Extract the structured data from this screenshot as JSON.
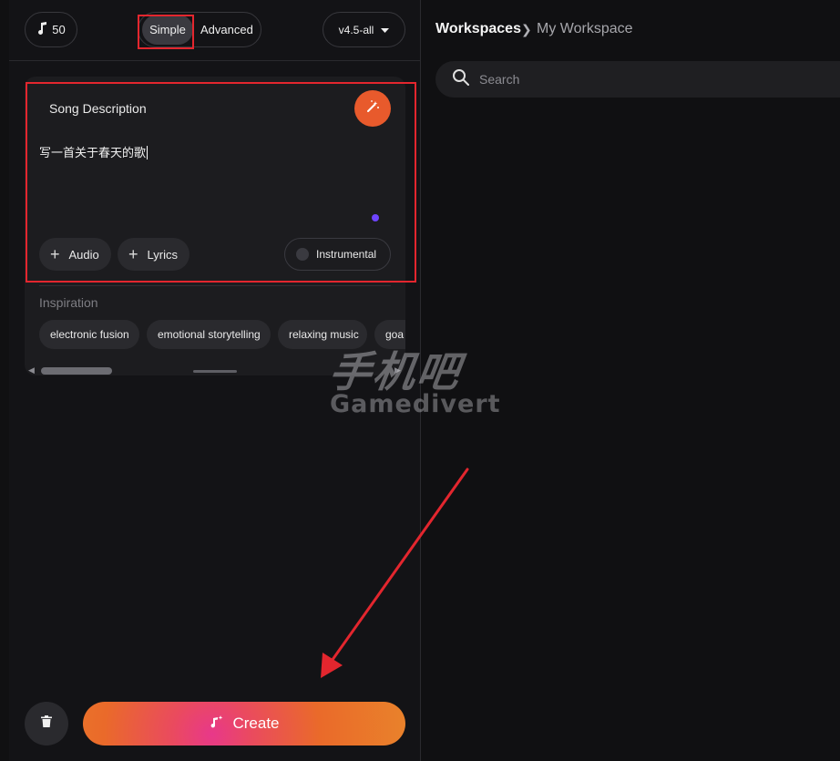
{
  "topbar": {
    "credits": "50",
    "mode_simple": "Simple",
    "mode_advanced": "Advanced",
    "model": "v4.5-all"
  },
  "composer": {
    "title": "Song Description",
    "prompt": "写一首关于春天的歌",
    "audio_label": "Audio",
    "lyrics_label": "Lyrics",
    "instrumental_label": "Instrumental"
  },
  "inspiration": {
    "label": "Inspiration",
    "tags": [
      "electronic fusion",
      "emotional storytelling",
      "relaxing music",
      "goa"
    ]
  },
  "actions": {
    "create_label": "Create"
  },
  "workspace": {
    "breadcrumb_root": "Workspaces",
    "breadcrumb_leaf": "My Workspace",
    "search_placeholder": "Search"
  },
  "watermark": {
    "cn": "手机吧",
    "en": "Gamedivert"
  },
  "colors": {
    "accent": "#e85a2c",
    "highlight_box": "#e3262e",
    "annotation_arrow": "#e3262e",
    "indicator": "#6e44ff"
  }
}
